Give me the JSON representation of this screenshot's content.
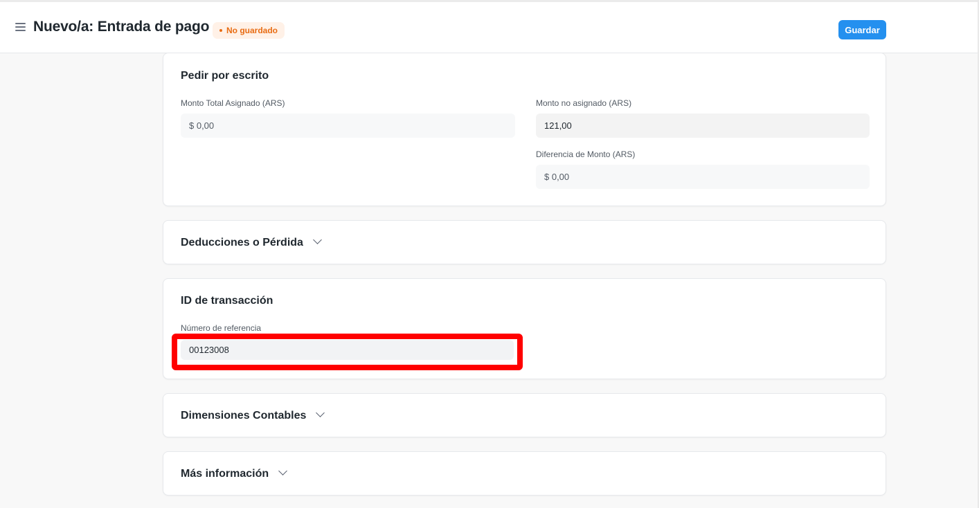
{
  "header": {
    "title": "Nuevo/a: Entrada de pago",
    "status_badge": "No guardado",
    "save_label": "Guardar"
  },
  "sections": {
    "write_off": {
      "title": "Pedir por escrito",
      "fields": {
        "total_allocated_label": "Monto Total Asignado (ARS)",
        "total_allocated_value": "$ 0,00",
        "unallocated_label": "Monto no asignado (ARS)",
        "unallocated_value": "121,00",
        "difference_label": "Diferencia de Monto (ARS)",
        "difference_value": "$ 0,00"
      }
    },
    "deductions": {
      "title": "Deducciones o Pérdida"
    },
    "transaction_id": {
      "title": "ID de transacción",
      "reference_label": "Número de referencia",
      "reference_value": "00123008"
    },
    "accounting_dimensions": {
      "title": "Dimensiones Contables"
    },
    "more_info": {
      "title": "Más información"
    }
  },
  "icons": {
    "menu": "hamburger-menu-icon",
    "collapse": "chevron-down-icon"
  },
  "colors": {
    "primary": "#2490ef",
    "status_orange": "#e86c13",
    "status_bg": "#fff1e7",
    "highlight": "#ff0000"
  }
}
